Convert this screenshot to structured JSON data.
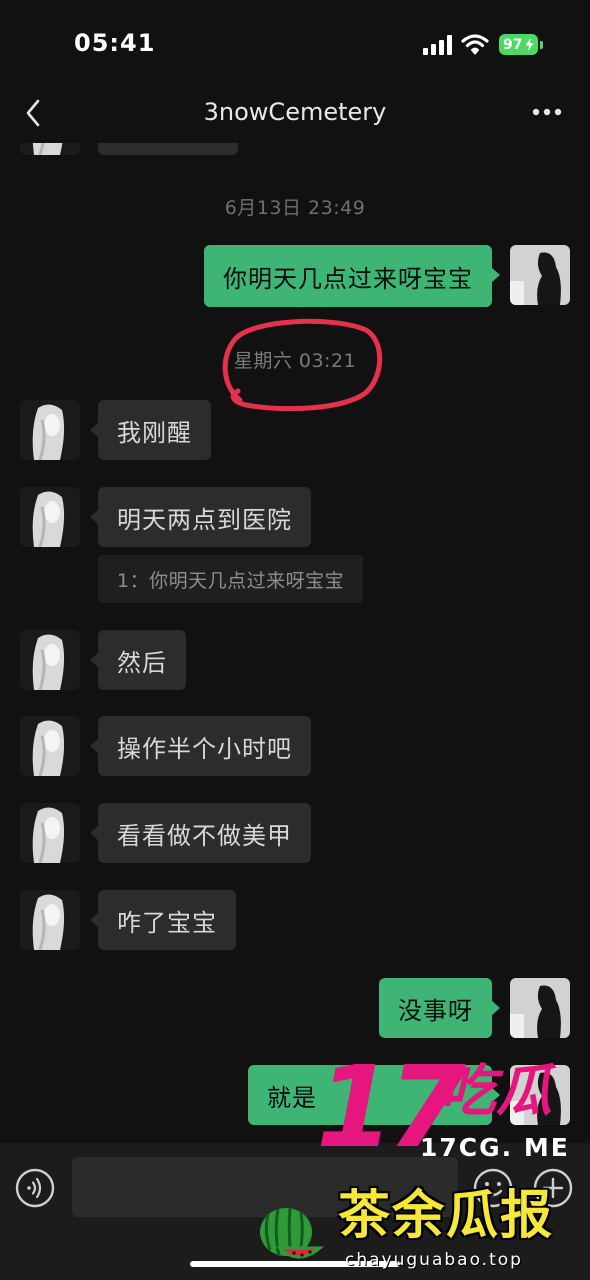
{
  "status_bar": {
    "time": "05:41",
    "battery_level": "97",
    "icons": [
      "signal-icon",
      "wifi-icon",
      "battery-charging-icon"
    ]
  },
  "nav": {
    "title": "3nowCemetery",
    "back_icon": "chevron-left-icon",
    "more_icon": "more-dots-icon"
  },
  "chat": {
    "timestamps": [
      "6月13日 23:49",
      "星期六 03:21"
    ],
    "highlighted_timestamp_index": 1,
    "messages": [
      {
        "side": "right",
        "text": "你明天几点过来呀宝宝"
      },
      {
        "side": "left",
        "text": "我刚醒"
      },
      {
        "side": "left",
        "text": "明天两点到医院",
        "quote": "1：你明天几点过来呀宝宝"
      },
      {
        "side": "left",
        "text": "然后"
      },
      {
        "side": "left",
        "text": "操作半个小时吧"
      },
      {
        "side": "left",
        "text": "看看做不做美甲"
      },
      {
        "side": "left",
        "text": "咋了宝宝"
      },
      {
        "side": "right",
        "text": "没事呀"
      },
      {
        "side": "right",
        "text": "就是"
      }
    ]
  },
  "input_bar": {
    "icons": [
      "voice-icon",
      "emoji-icon",
      "plus-icon"
    ]
  },
  "watermark": {
    "logo_numeral": "17",
    "logo_chars": "吃瓜",
    "domain": "17CG. ME",
    "brand": "茶余瓜报",
    "brand_domain": "chayuguabao.top"
  },
  "colors": {
    "background": "#111111",
    "bubble_self": "#3eb575",
    "bubble_other": "#2c2c2c",
    "highlight_circle": "#e5314b",
    "watermark": "#e5177e",
    "battery": "#4cd964"
  }
}
